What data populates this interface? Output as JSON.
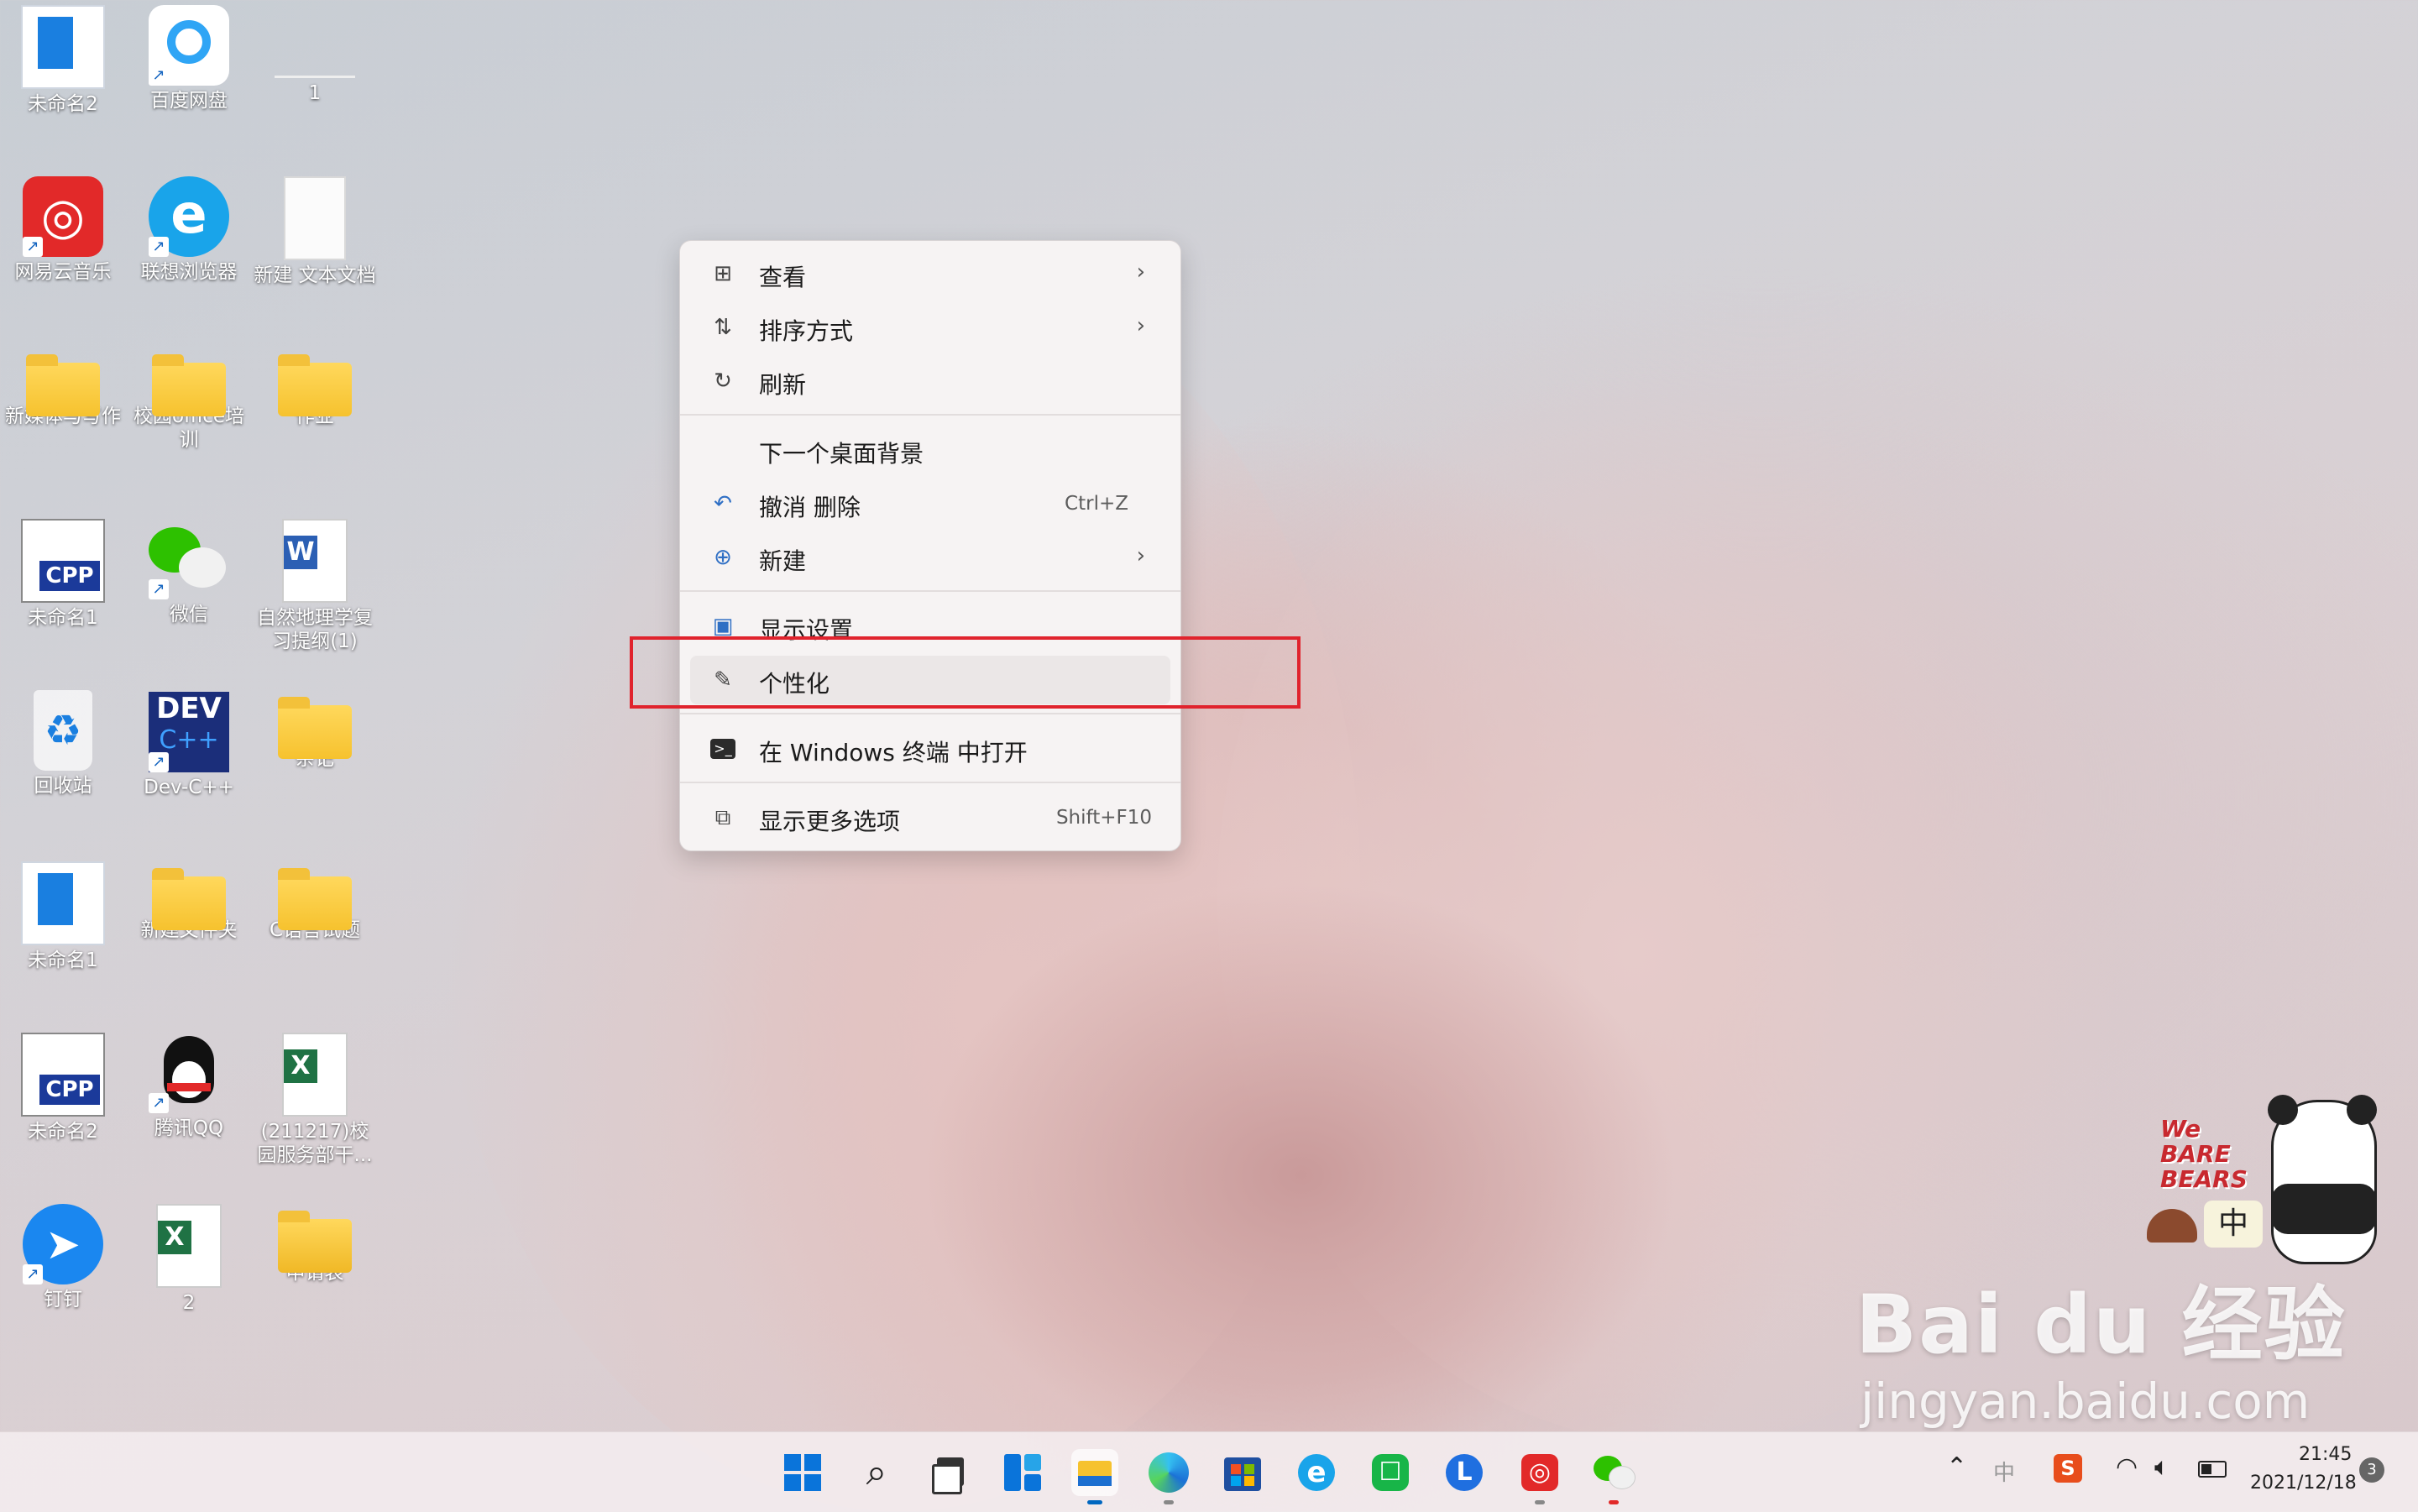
{
  "desktop": {
    "icons": [
      {
        "label": "未命名2",
        "icon": "blue-doc-icon"
      },
      {
        "label": "百度网盘",
        "icon": "baidu-netdisk-icon"
      },
      {
        "label": "1",
        "icon": "blank-file-icon"
      },
      {
        "label": "网易云音乐",
        "icon": "netease-music-icon"
      },
      {
        "label": "联想浏览器",
        "icon": "lenovo-browser-icon"
      },
      {
        "label": "新建 文本文档",
        "icon": "text-file-icon"
      },
      {
        "label": "新媒体与写作",
        "icon": "folder-icon"
      },
      {
        "label": "校园office培训",
        "icon": "folder-icon"
      },
      {
        "label": "作业",
        "icon": "folder-icon"
      },
      {
        "label": "未命名1",
        "icon": "cpp-file-icon"
      },
      {
        "label": "微信",
        "icon": "wechat-icon"
      },
      {
        "label": "自然地理学复习提纲(1)",
        "icon": "word-file-icon"
      },
      {
        "label": "回收站",
        "icon": "recycle-bin-icon"
      },
      {
        "label": "Dev-C++",
        "icon": "devcpp-icon"
      },
      {
        "label": "杂记",
        "icon": "folder-icon"
      },
      {
        "label": "未命名1",
        "icon": "blue-doc-icon"
      },
      {
        "label": "新建文件夹",
        "icon": "folder-icon"
      },
      {
        "label": "C语言试题",
        "icon": "folder-icon"
      },
      {
        "label": "未命名2",
        "icon": "cpp-file-icon"
      },
      {
        "label": "腾讯QQ",
        "icon": "qq-icon"
      },
      {
        "label": "(211217)校园服务部干...",
        "icon": "excel-file-icon"
      },
      {
        "label": "钉钉",
        "icon": "dingtalk-icon"
      },
      {
        "label": "2",
        "icon": "excel-file-icon"
      },
      {
        "label": "申请表",
        "icon": "zip-folder-icon"
      }
    ]
  },
  "context_menu": {
    "items": [
      {
        "label": "查看",
        "icon": "grid-view-icon",
        "chevron": "›"
      },
      {
        "label": "排序方式",
        "icon": "sort-icon",
        "chevron": "›"
      },
      {
        "label": "刷新",
        "icon": "refresh-icon"
      },
      {
        "label": "下一个桌面背景",
        "icon": ""
      },
      {
        "label": "撤消 删除",
        "icon": "undo-icon",
        "shortcut": "Ctrl+Z"
      },
      {
        "label": "新建",
        "icon": "new-plus-icon",
        "chevron": "›"
      },
      {
        "label": "显示设置",
        "icon": "display-settings-icon"
      },
      {
        "label": "个性化",
        "icon": "brush-icon"
      },
      {
        "label": "在 Windows 终端 中打开",
        "icon": "terminal-icon"
      },
      {
        "label": "显示更多选项",
        "icon": "more-options-icon",
        "shortcut": "Shift+F10"
      }
    ]
  },
  "taskbar": {
    "apps": [
      "start-icon",
      "search-icon",
      "task-view-icon",
      "widgets-icon",
      "file-explorer-icon",
      "edge-icon",
      "store-icon",
      "lenovo-browser-icon",
      "wechat-work-icon",
      "lenovo-l-icon",
      "netease-music-icon",
      "wechat-icon"
    ],
    "tray": {
      "ime": "中",
      "time": "21:45",
      "date": "2021/12/18",
      "notifications": "3"
    }
  },
  "badge": {
    "brand": "We BARE BEARS",
    "ime": "中"
  },
  "watermark": {
    "main": "Bai du 经验",
    "url": "jingyan.baidu.com"
  },
  "colors": {
    "highlight": "#e0232d",
    "folder": "#f6c22e",
    "accent": "#0067c0"
  }
}
